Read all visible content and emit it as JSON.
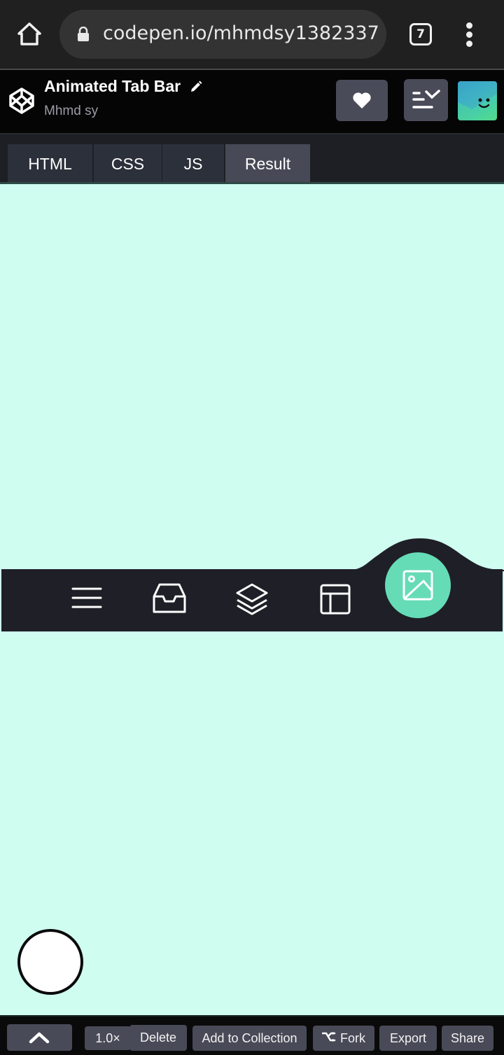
{
  "browser": {
    "url": "codepen.io/mhmdsy1382337",
    "tab_count": "7",
    "icons": {
      "home": "home-icon",
      "lock": "lock-icon",
      "menu": "more-vert-icon"
    }
  },
  "header": {
    "title": "Animated Tab Bar",
    "author": "Mhmd sy",
    "icons": {
      "logo": "codepen-logo-icon",
      "edit": "pencil-icon",
      "heart": "heart-icon",
      "layout": "layout-toggle-icon"
    }
  },
  "editor_tabs": [
    {
      "label": "HTML",
      "active": false
    },
    {
      "label": "CSS",
      "active": false
    },
    {
      "label": "JS",
      "active": false
    },
    {
      "label": "Result",
      "active": true
    }
  ],
  "result": {
    "background": "#cffdf0",
    "tab_bar": {
      "background": "#1f1f27",
      "accent": "#66dcb6",
      "items": [
        {
          "icon": "menu-icon",
          "active": false
        },
        {
          "icon": "inbox-icon",
          "active": false
        },
        {
          "icon": "layers-icon",
          "active": false
        },
        {
          "icon": "layout-icon",
          "active": false
        },
        {
          "icon": "image-icon",
          "active": true
        }
      ]
    }
  },
  "bottom_bar": {
    "zoom": "1.0×",
    "delete": "Delete",
    "add_to_collection": "Add to Collection",
    "fork": "Fork",
    "export": "Export",
    "share": "Share",
    "icons": {
      "up": "chevron-up-icon",
      "fork": "fork-icon"
    }
  }
}
